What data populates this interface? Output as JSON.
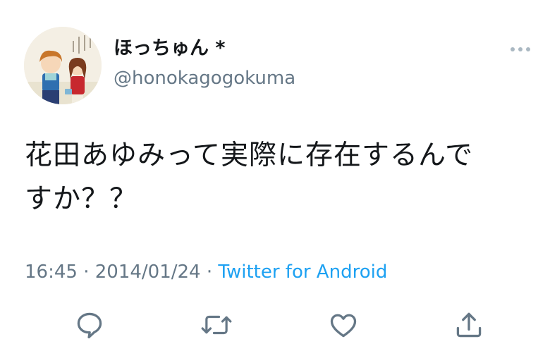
{
  "user": {
    "display_name": "ほっちゅん *",
    "handle": "@honokagogokuma"
  },
  "tweet": {
    "text_line1": "花田あゆみって実際に存在するんで",
    "text_line2": "すか？？"
  },
  "meta": {
    "time": "16:45",
    "separator1": " · ",
    "date": "2014/01/24",
    "separator2": " · ",
    "source": "Twitter for Android"
  },
  "icons": {
    "more": "more-options-icon",
    "reply": "reply-icon",
    "retweet": "retweet-icon",
    "like": "like-icon",
    "share": "share-icon"
  },
  "colors": {
    "text": "#14171a",
    "secondary": "#657786",
    "link": "#1da1f2",
    "icon": "#657786"
  }
}
